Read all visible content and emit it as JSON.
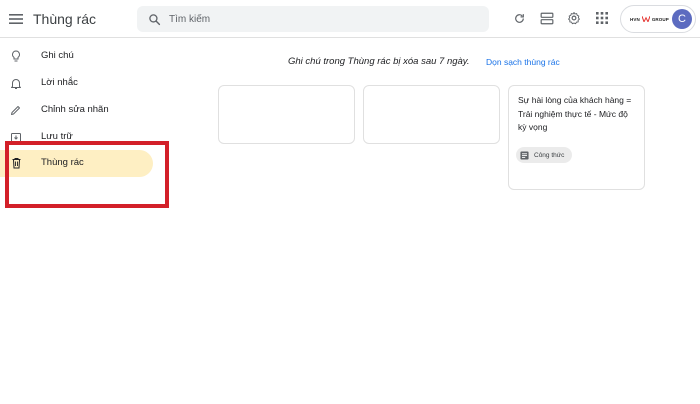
{
  "header": {
    "title": "Thùng rác",
    "search_placeholder": "Tìm kiếm",
    "org_logo_left": "HVN",
    "org_logo_right": "GROUP",
    "avatar_initial": "C"
  },
  "sidebar": {
    "items": [
      {
        "label": "Ghi chú",
        "icon": "lightbulb-icon",
        "active": false
      },
      {
        "label": "Lời nhắc",
        "icon": "bell-icon",
        "active": false
      },
      {
        "label": "Chỉnh sửa nhãn",
        "icon": "pencil-icon",
        "active": false
      },
      {
        "label": "Lưu trữ",
        "icon": "archive-icon",
        "active": false
      },
      {
        "label": "Thùng rác",
        "icon": "trash-icon",
        "active": true
      }
    ]
  },
  "main": {
    "trash_notice": "Ghi chú trong Thùng rác bị xóa sau 7 ngày.",
    "empty_trash_label": "Dọn sạch thùng rác",
    "notes": [
      {
        "text": "",
        "label": ""
      },
      {
        "text": "",
        "label": ""
      },
      {
        "text": "Sự hài lòng của khách hàng = Trải nghiệm thực tế - Mức độ kỳ vọng",
        "label": "Công thức"
      }
    ]
  },
  "colors": {
    "active_nav": "#feefc3",
    "highlight_border": "#d32029",
    "link": "#1a73e8",
    "avatar": "#5c6bc0"
  }
}
